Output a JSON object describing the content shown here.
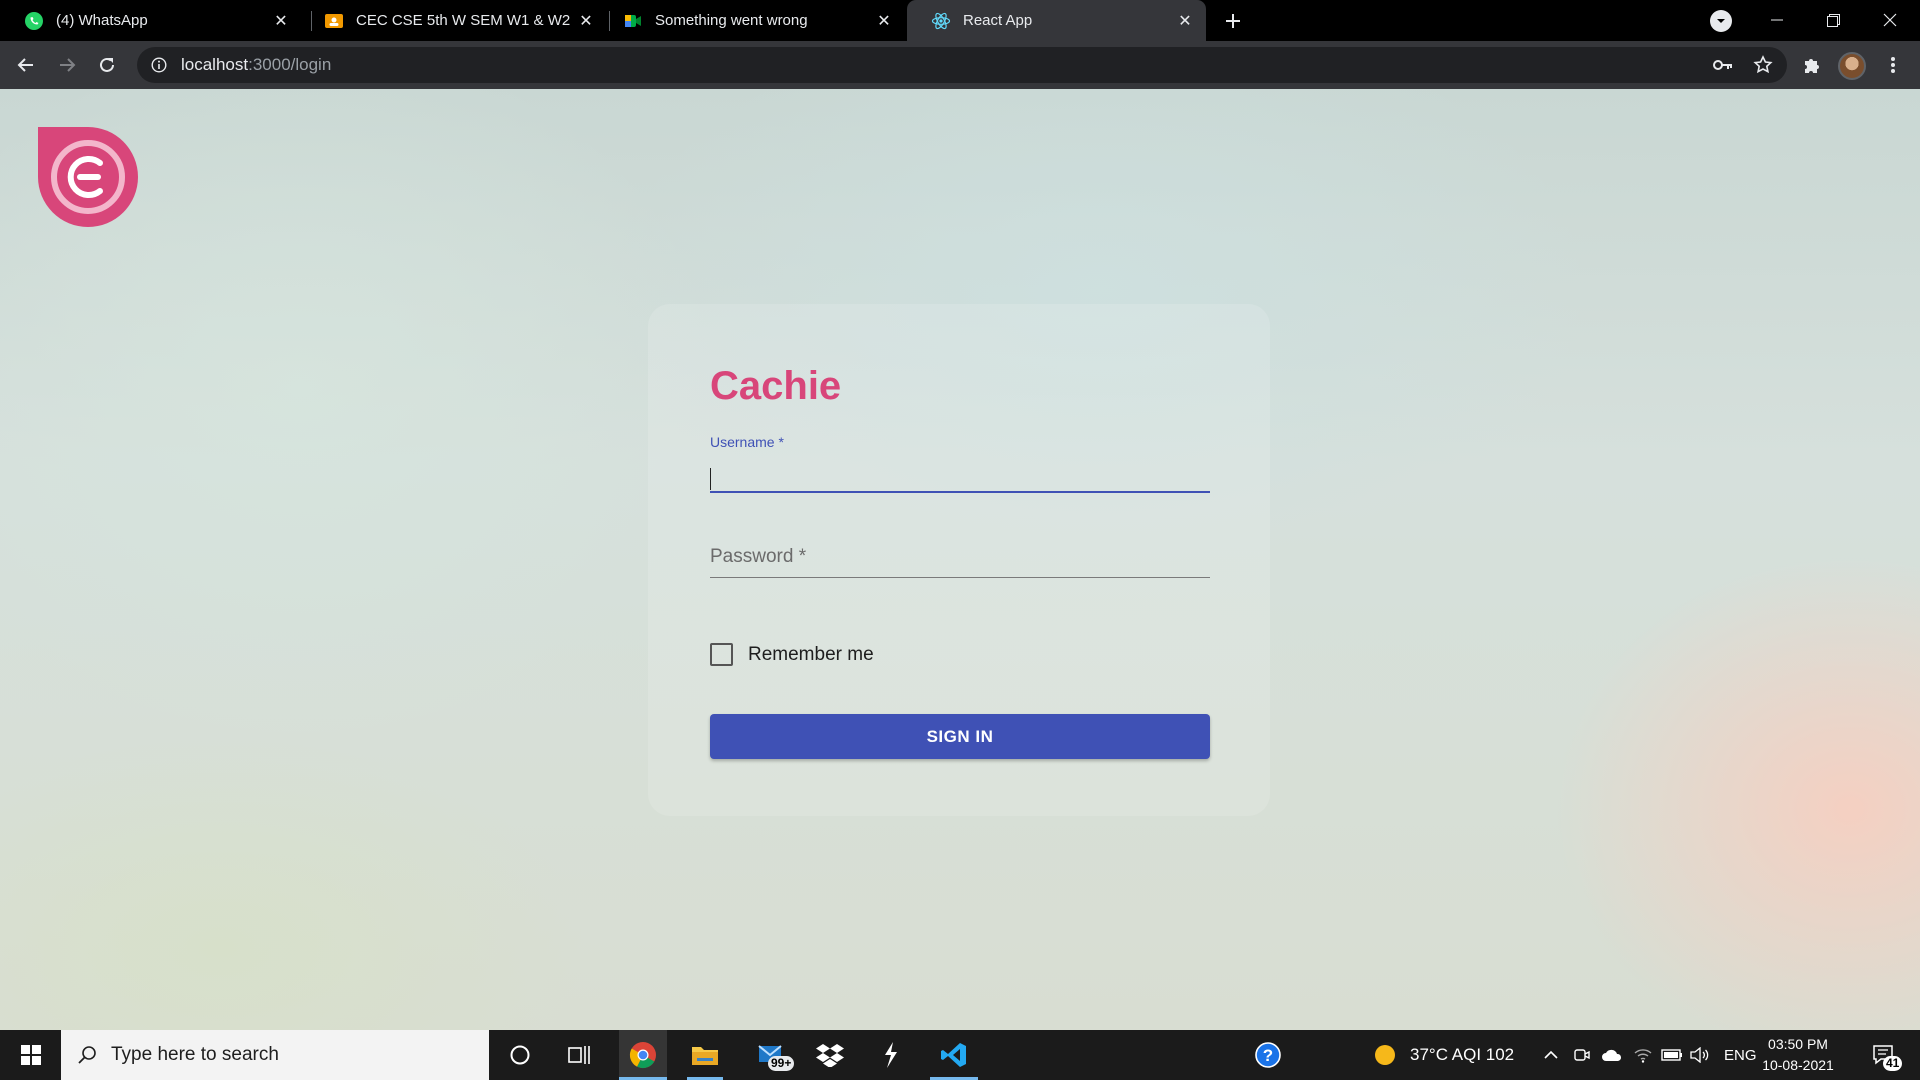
{
  "browser": {
    "tabs": [
      {
        "title": "(4) WhatsApp",
        "icon": "whatsapp-icon",
        "active": false
      },
      {
        "title": "CEC CSE 5th W SEM W1 & W2",
        "icon": "classroom-icon",
        "active": false
      },
      {
        "title": "Something went wrong",
        "icon": "meet-icon",
        "active": false
      },
      {
        "title": "React App",
        "icon": "react-icon",
        "active": true
      }
    ],
    "address": {
      "host": "localhost",
      "path": ":3000/login"
    }
  },
  "login": {
    "brand": "Cachie",
    "username_label": "Username *",
    "username_value": "",
    "password_label": "Password *",
    "remember_label": "Remember me",
    "remember_checked": false,
    "signin_label": "SIGN IN"
  },
  "taskbar": {
    "search_placeholder": "Type here to search",
    "mail_badge": "99+",
    "weather": "37°C  AQI 102",
    "language": "ENG",
    "time": "03:50 PM",
    "date": "10-08-2021",
    "notification_count": "41"
  },
  "colors": {
    "brand": "#d8467a",
    "primary": "#3f51b5",
    "tabstrip": "#000000",
    "toolbar": "#35363a"
  }
}
